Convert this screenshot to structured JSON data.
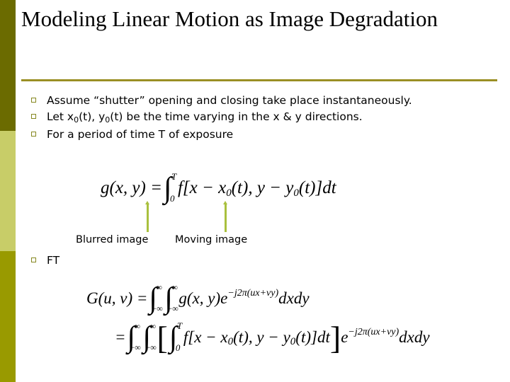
{
  "slide": {
    "title": "Modeling Linear Motion as Image Degradation",
    "accent_color": "#9a8f24",
    "arrow_color": "#a9c03e",
    "bullet_marker_color": "#85871f",
    "background_color": "#ffffff"
  },
  "sidebar": {
    "bands": [
      {
        "name": "top-band",
        "color": "#6b6b00"
      },
      {
        "name": "middle-band",
        "color": "#c8cd68"
      },
      {
        "name": "bottom-band",
        "color": "#999a00"
      }
    ]
  },
  "bullets": [
    {
      "marker": "hollow-square-bullet",
      "text_before_sub": "Assume “shutter” opening and closing take place instantaneously.",
      "full_text": "Assume “shutter” opening and closing take place instantaneously."
    },
    {
      "marker": "hollow-square-bullet",
      "full_text": "Let x0(t), y0(t) be the time varying in the x & y directions.",
      "seg1": "Let x",
      "sub1": "0",
      "seg2": "(t), y",
      "sub2": "0",
      "seg3": "(t) be the time varying in the x & y directions."
    },
    {
      "marker": "hollow-square-bullet",
      "full_text": "For a period of time T of exposure"
    }
  ],
  "ft_bullet": {
    "marker": "hollow-square-bullet",
    "label": "FT"
  },
  "annotations": [
    {
      "name": "blurred-image-caption",
      "label": "Blurred image",
      "arrow": "up-arrow"
    },
    {
      "name": "moving-image-caption",
      "label": "Moving image",
      "arrow": "up-arrow"
    }
  ],
  "equations": {
    "eq1": {
      "plain": "g(x, y) = ∫_0^T f[x − x0(t), y − y0(t)]dt",
      "lhs": "g(x, y) =",
      "integral_upper": "T",
      "integral_lower": "0",
      "integrand_a": "f[x − x",
      "sub_a": "0",
      "integrand_b": "(t), y − y",
      "sub_b": "0",
      "integrand_c": "(t)]dt"
    },
    "eq2": {
      "plain": "G(u, v) = ∫_{-∞}^{∞} ∫_{-∞}^{∞} g(x, y)e^{-j2π(ux+vy)}dxdy",
      "lhs": "G(u, v) =",
      "limit_upper": "∞",
      "limit_lower": "−∞",
      "body": "g(x, y)e",
      "exponent": "−j2π(ux+vy)",
      "tail": "dxdy"
    },
    "eq3": {
      "plain": "= ∫_{-∞}^{∞} ∫_{-∞}^{∞} [ ∫_0^T f[x − x0(t), y − y0(t)]dt ] e^{-j2π(ux+vy)}dxdy",
      "lhs": "=",
      "limit_upper": "∞",
      "limit_lower": "−∞",
      "inner_upper": "T",
      "inner_lower": "0",
      "inner_a": "f[x − x",
      "sub_a": "0",
      "inner_b": "(t), y − y",
      "sub_b": "0",
      "inner_c": "(t)]dt",
      "exponent_base": "e",
      "exponent": "−j2π(ux+vy)",
      "tail": "dxdy"
    }
  }
}
